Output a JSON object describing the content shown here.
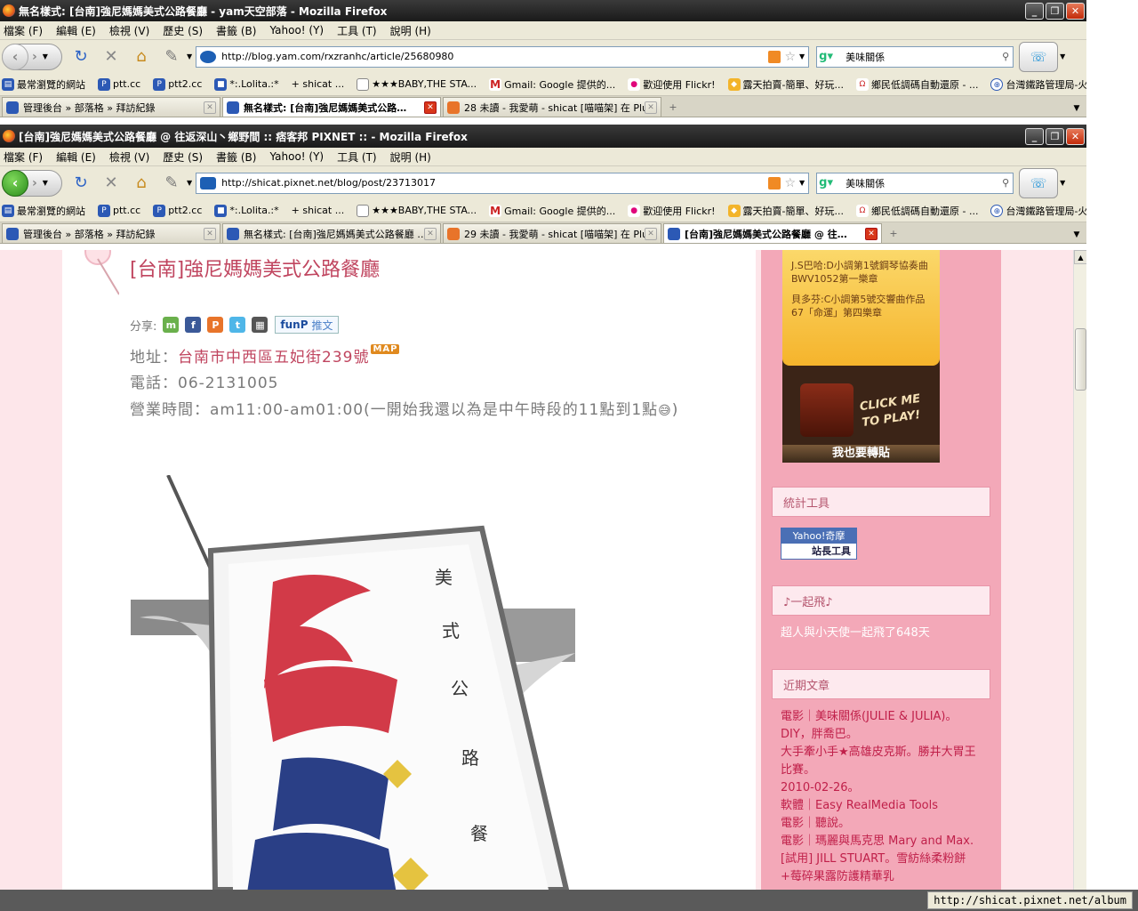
{
  "windows": [
    {
      "title": "無名樣式: [台南]強尼媽媽美式公路餐廳 - yam天空部落 - Mozilla Firefox",
      "url": "http://blog.yam.com/rxzranhc/article/25680980",
      "tabs": [
        {
          "label": "管理後台 » 部落格 » 拜訪紀錄",
          "active": false
        },
        {
          "label": "無名樣式: [台南]強尼媽媽美式公路…",
          "active": true
        },
        {
          "label": "28 未讀 - 我愛萌 - shicat [喵喵架] 在 Plu…",
          "active": false
        }
      ]
    },
    {
      "title": "[台南]強尼媽媽美式公路餐廳 @ 往返深山丶鄉野間 :: 痞客邦 PIXNET :: - Mozilla Firefox",
      "url": "http://shicat.pixnet.net/blog/post/23713017",
      "tabs": [
        {
          "label": "管理後台 » 部落格 » 拜訪紀錄",
          "active": false
        },
        {
          "label": "無名樣式: [台南]強尼媽媽美式公路餐廳 …",
          "active": false
        },
        {
          "label": "29 未讀 - 我愛萌 - shicat [喵喵架] 在 Plu…",
          "active": false
        },
        {
          "label": "[台南]強尼媽媽美式公路餐廳 @ 往…",
          "active": true
        }
      ]
    }
  ],
  "menu": [
    "檔案 (F)",
    "編輯 (E)",
    "檢視 (V)",
    "歷史 (S)",
    "書籤 (B)",
    "Yahoo! (Y)",
    "工具 (T)",
    "說明 (H)"
  ],
  "search_value": "美味關係",
  "bookmarks": [
    "最常瀏覽的網站",
    "ptt.cc",
    "ptt2.cc",
    "*:.Lolita.:*",
    "+ shicat ...",
    "★★★BABY,THE STA...",
    "Gmail: Google 提供的...",
    "歡迎使用 Flickr!",
    "露天拍賣-簡單、好玩...",
    "鄉民低調碼自動還原 - ...",
    "台灣鐵路管理局-火車..."
  ],
  "post": {
    "title": "[台南]強尼媽媽美式公路餐廳",
    "share_label": "分享:",
    "funp_brand": "funP",
    "funp_label": "推文",
    "address_label": "地址：",
    "address_value": "台南市中西區五妃街239號",
    "map_badge": "MAP",
    "phone": "電話：06-2131005",
    "hours": "營業時間：am11:00-am01:00(一開始我還以為是中午時段的11點到1點",
    "hours_close": ")",
    "sign_vertical": [
      "美",
      "式",
      "公",
      "路",
      "餐"
    ]
  },
  "sidebar": {
    "music": {
      "track1": "J.S巴哈:D小調第1號鋼琴協奏曲BWV1052第一樂章",
      "track2": "貝多芬:C小調第5號交響曲作品67「命運」第四樂章",
      "click": "CLICK ME TO PLAY!",
      "share": "我也要轉貼"
    },
    "stats_title": "統計工具",
    "yahoo_top": "Yahoo!奇摩",
    "yahoo_bottom": "站長工具",
    "fly_title": "♪一起飛♪",
    "fly_text": "超人與小天使一起飛了648天",
    "recent_title": "近期文章",
    "recent": [
      "電影｜美味關係(JULIE & JULIA)。",
      "DIY，胖喬巴。",
      "大手牽小手★高雄皮克斯。勝井大胃王比賽。",
      "2010-02-26。",
      "軟體｜Easy RealMedia Tools",
      "電影｜聽說。",
      "電影｜瑪麗與馬克思 Mary and Max.",
      "[試用] JILL STUART。雪紡絲柔粉餅+莓碎果露防護精華乳"
    ]
  },
  "status_url": "http://shicat.pixnet.net/album",
  "colors": {
    "accent": "#c0455f",
    "sidebar": "#f3a8b8",
    "page_bg": "#fde6ea"
  }
}
